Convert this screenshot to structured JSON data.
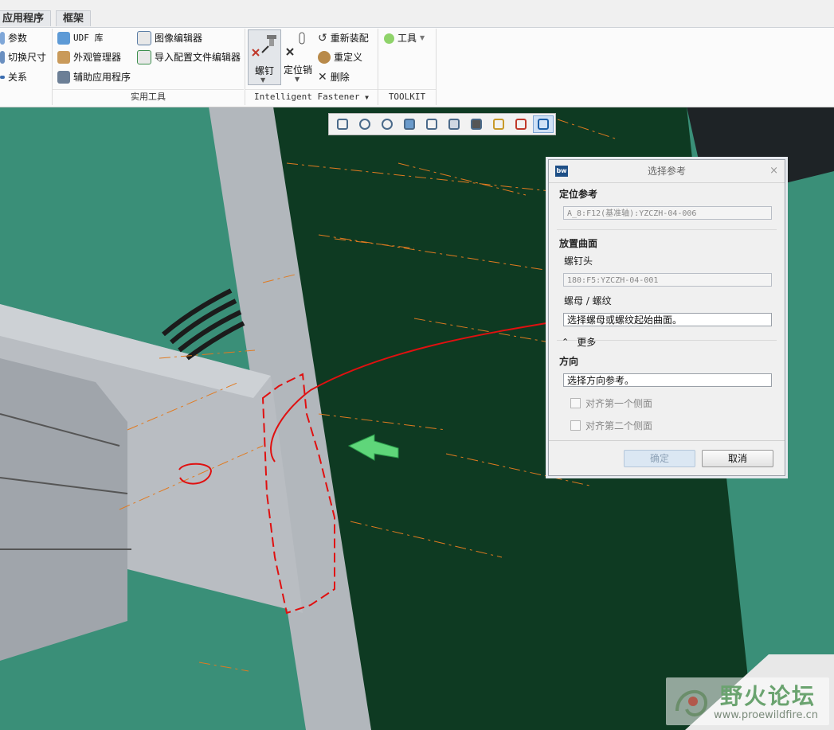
{
  "ribbon": {
    "tabs": [
      "应用程序",
      "框架"
    ],
    "col1": [
      "参数",
      "切换尺寸",
      "关系"
    ],
    "col2": [
      "UDF 库",
      "外观管理器",
      "辅助应用程序"
    ],
    "col3": [
      "图像编辑器",
      "导入配置文件编辑器"
    ],
    "group_utilities": "实用工具",
    "screw_label": "螺钉",
    "locate_label": "定位销",
    "col5": [
      "重新装配",
      "重定义",
      "删除"
    ],
    "group_fastener": "Intelligent Fastener",
    "tools_label": "工具",
    "group_toolkit": "TOOLKIT"
  },
  "view_toolbar": {
    "icons": [
      "refit-icon",
      "zoom-in-icon",
      "zoom-out-icon",
      "repaint-icon",
      "saved-views-icon",
      "display-style-icon",
      "snapshot-icon",
      "datum-display-icon",
      "spin-center-icon",
      "annotation-icon"
    ]
  },
  "dialog": {
    "logo": "bw",
    "title": "选择参考",
    "close": "×",
    "locate_ref_heading": "定位参考",
    "locate_ref_value": "A_8:F12(基准轴):YZCZH-04-006",
    "placement_heading": "放置曲面",
    "screw_head_label": "螺钉头",
    "screw_head_value": "180:F5:YZCZH-04-001",
    "nut_label": "螺母 / 螺纹",
    "nut_value": "选择螺母或螺纹起始曲面。",
    "more_label": "更多",
    "direction_heading": "方向",
    "direction_value": "选择方向参考。",
    "align_first": "对齐第一个侧面",
    "align_second": "对齐第二个侧面",
    "ok": "确定",
    "cancel": "取消"
  },
  "watermark": {
    "name": "野火论坛",
    "url": "www.proewildfire.cn"
  },
  "colors": {
    "viewport_teal": "#3a8f78",
    "dark_plate": "#0e3a22",
    "beam_gray": "#b4b8bd",
    "annotation_red": "#e01010"
  }
}
